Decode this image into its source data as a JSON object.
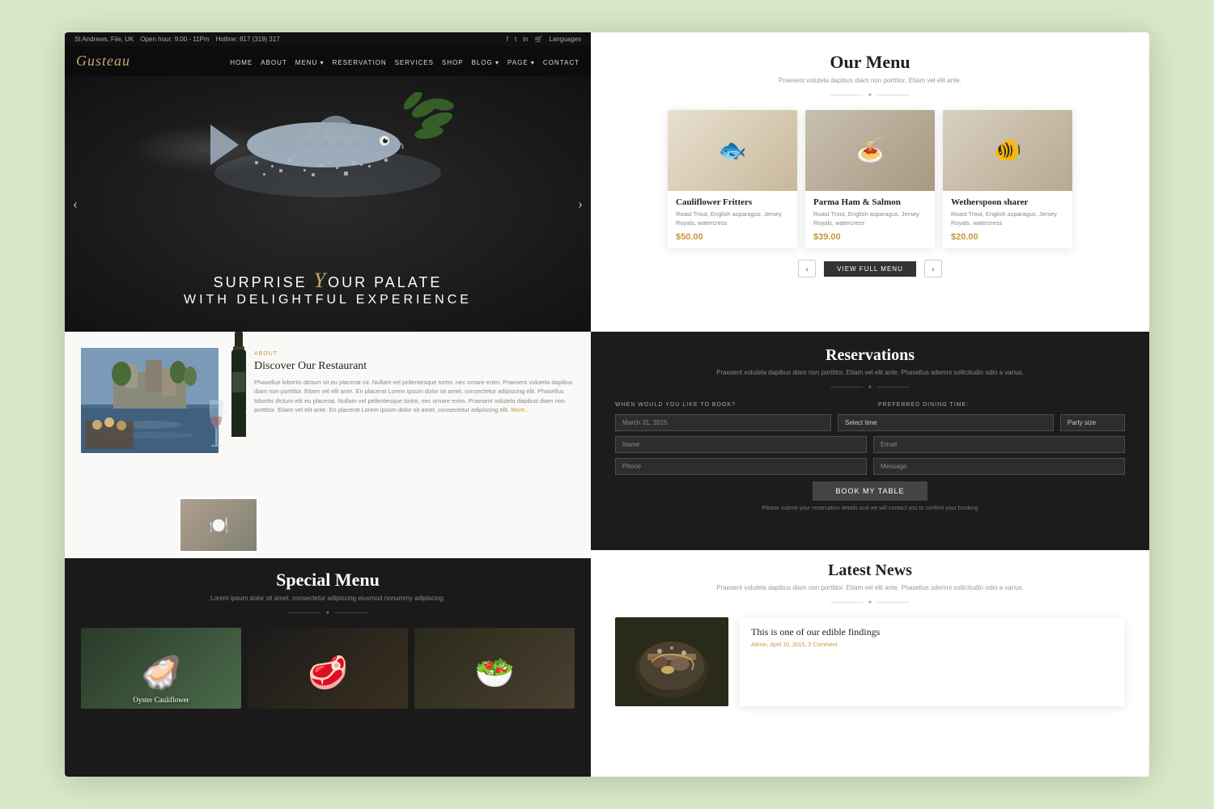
{
  "site": {
    "name": "Gusteau",
    "tagline": "SURPRISE YOUR PALATE",
    "tagline_italic": "y",
    "hero_subtitle": "WITH DELIGHTFUL EXPERIENCE"
  },
  "topbar": {
    "address": "St Andrews, File, UK",
    "hours": "Open hour: 9:00 - 11Pm",
    "hotline": "Hotline: 817 (319) 317",
    "language": "Languages"
  },
  "nav": {
    "links": [
      "HOME",
      "ABOUT",
      "MENU",
      "RESERVATION",
      "SERVICES",
      "SHOP",
      "BLOG",
      "PAGE",
      "CONTACT"
    ]
  },
  "our_menu": {
    "title": "Our Menu",
    "subtitle": "Praesent volutela dapibus diam non porttitor. Etiam vel elit ante.",
    "view_full_label": "View Full Menu",
    "items": [
      {
        "name": "Cauliflower Fritters",
        "desc": "Roast Trout, English asparagus, Jersey Royals, watercress",
        "price": "$50.00",
        "img_type": "fish"
      },
      {
        "name": "Parma Ham & Salmon",
        "desc": "Roast Trout, English asparagus, Jersey Royals, watercress",
        "price": "$39.00",
        "img_type": "pasta"
      },
      {
        "name": "Wetherspoon sharer",
        "desc": "Roast Trout, English asparagus, Jersey Royals, watercress",
        "price": "$20.00",
        "img_type": "sardine"
      }
    ]
  },
  "discover": {
    "tag": "About",
    "title": "Discover Our Restaurant",
    "text": "Phasellus lobortis dictum sit eu placerat mi. Nullam vel pellentesque tortor, nec ornare enim. Praesent volutela dapibus diam non porttitor. Etiam vel elit ante. En placerat Lorem ipsum dolor sit amet, consectetur adipiscing elit. Phasellus lobortis dictum elit eu placerat. Nullam vel pellentesque tortor, nec ornare enim. Praesent volutela dapibus diam non porttitor. Etiam vel elit ante. En placerat Lorem ipsum dolor sit amet, consectetur adipiscing elit.",
    "more": "More..."
  },
  "special_menu": {
    "title": "Special Menu",
    "subtitle": "Lorem ipsum dolor sit amet, consectetur adipiscing eiusmod nonummy adipiscing.",
    "items": [
      {
        "label": "Oyster Cauliflower"
      },
      {
        "label": ""
      },
      {
        "label": ""
      }
    ]
  },
  "reservations": {
    "title": "Reservations",
    "subtitle": "Praesent volutela dapibus diam non porttitor. Etiam vel elit ante. Phasellus sdemni sollicitudin odio a varius.",
    "when_label": "WHEN WOULD YOU LIKE TO BOOK?",
    "preferred_label": "PREFERRED DINING TIME:",
    "date_placeholder": "March 31, 2015",
    "time_placeholder": "Select time",
    "party_placeholder": "Party size",
    "name_placeholder": "Name",
    "email_placeholder": "Email",
    "phone_placeholder": "Phone",
    "message_placeholder": "Message",
    "book_btn": "Book my table",
    "note": "Please submit your reservation details and we will contact you to confirm your booking"
  },
  "latest_news": {
    "title": "Latest News",
    "subtitle": "Praesent volutela dapibus diam non porttitor. Etiam vel elit ante. Phasellus sdemni sollicitudin odio a varius.",
    "article_title": "This is one of our edible findings",
    "article_meta": "Admin, April 10, 2015, 3 Comment"
  }
}
